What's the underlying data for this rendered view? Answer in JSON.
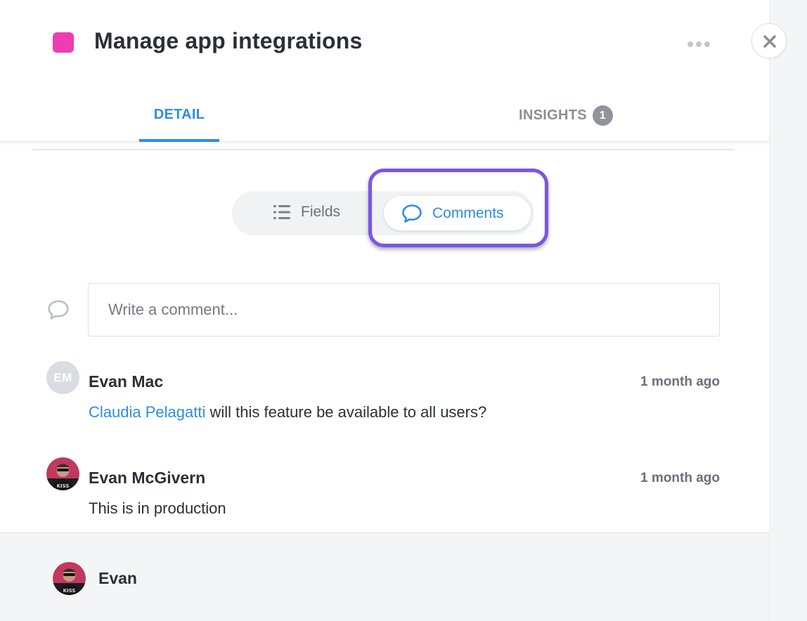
{
  "header": {
    "title": "Manage app integrations",
    "color": "#ee3db2"
  },
  "tabs": [
    {
      "label": "DETAIL",
      "active": true
    },
    {
      "label": "INSIGHTS",
      "badge": "1",
      "active": false
    }
  ],
  "view_toggle": {
    "fields_label": "Fields",
    "comments_label": "Comments",
    "selected": "Comments",
    "highlight_color": "#7a55e6"
  },
  "comment_input": {
    "placeholder": "Write a comment...",
    "value": ""
  },
  "comments": [
    {
      "author": "Evan Mac",
      "initials": "EM",
      "time": "1 month ago",
      "mention": "Claudia Pelagatti",
      "text": " will this feature be available to all users?"
    },
    {
      "author": "Evan McGivern",
      "time": "1 month ago",
      "text": "This is in production"
    }
  ],
  "footer": {
    "user_name": "Evan"
  },
  "colors": {
    "accent": "#2d8de6",
    "text": "#2b2f36",
    "muted": "#6b7178"
  }
}
